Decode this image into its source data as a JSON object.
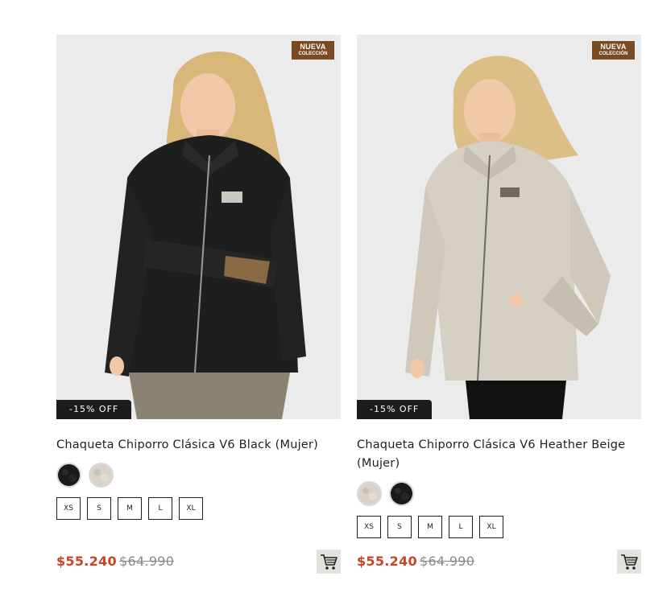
{
  "products": [
    {
      "badge_new": {
        "line1": "NUEVA",
        "line2": "COLECCIÓN"
      },
      "discount": "-15% OFF",
      "title": "Chaqueta Chiporro Clásica V6 Black (Mujer)",
      "swatches": [
        "black",
        "heather-beige"
      ],
      "sizes": [
        "XS",
        "S",
        "M",
        "L",
        "XL"
      ],
      "price": "$55.240",
      "price_old": "$64.990",
      "jacket_color": "#1e1e1e",
      "jacket_shade": "#2a2a2a"
    },
    {
      "badge_new": {
        "line1": "NUEVA",
        "line2": "COLECCIÓN"
      },
      "discount": "-15% OFF",
      "title": "Chaqueta Chiporro Clásica V6 Heather Beige (Mujer)",
      "swatches": [
        "heather-beige",
        "black"
      ],
      "sizes": [
        "XS",
        "S",
        "M",
        "L",
        "XL"
      ],
      "price": "$55.240",
      "price_old": "$64.990",
      "jacket_color": "#d6d0c4",
      "jacket_shade": "#c6bfb1"
    }
  ],
  "colors": {
    "price": "#c94424",
    "badge_new_bg": "#7a4a22",
    "badge_off_bg": "#1c1c1c",
    "cart_bg": "#e3e3dd"
  }
}
